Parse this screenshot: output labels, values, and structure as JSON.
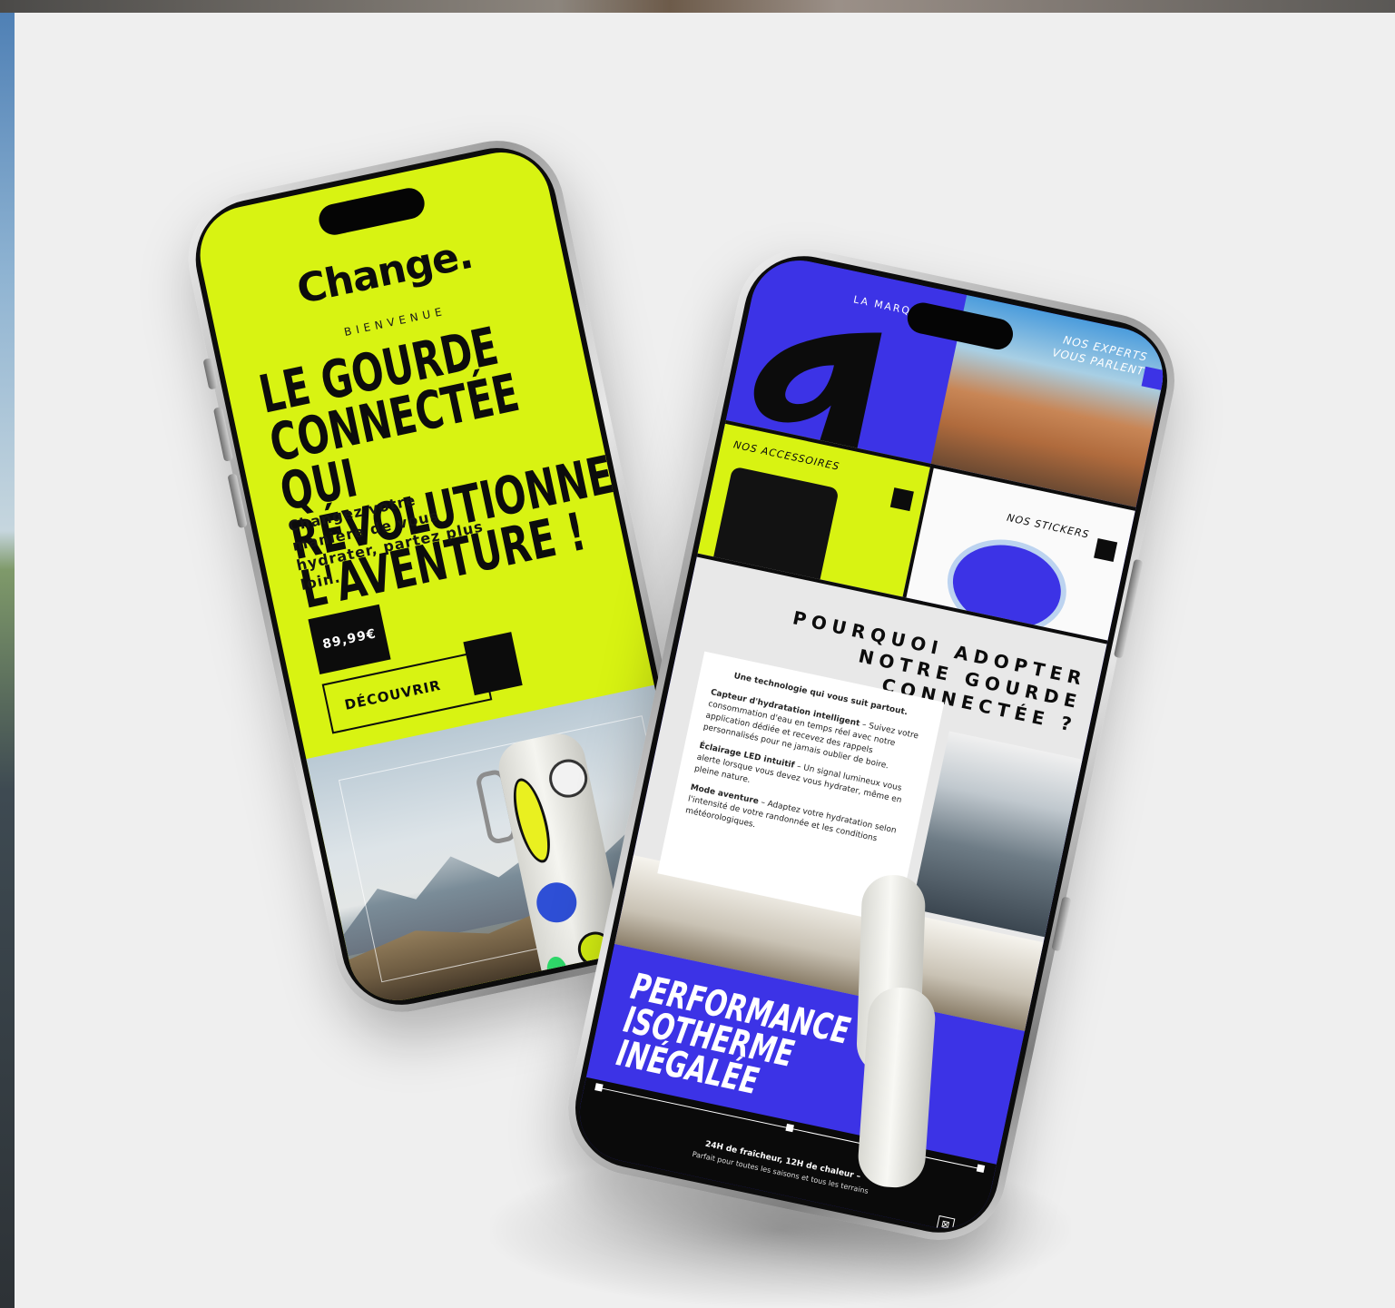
{
  "background": {
    "accent_yellow": "#d8f312",
    "accent_blue": "#3c33e6",
    "dark": "#0c0c0c"
  },
  "phone_left": {
    "logo": "Change.",
    "eyebrow": "BIENVENUE",
    "headline": "LE GOURDE CONNECTÉE QUI RÉVOLUTIONNE L'AVENTURE !",
    "subtitle": "Changez votre manière de vous hydrater, partez plus loin.",
    "price": "89,99€",
    "cta_label": "DÉCOUVRIR"
  },
  "phone_right": {
    "tiles": {
      "brand_label": "LA MARQUE",
      "experts_label": "NOS EXPERTS VOUS PARLENT",
      "accessories_label": "NOS ACCESSOIRES",
      "stickers_label": "NOS STICKERS"
    },
    "why": {
      "title": "POURQUOI ADOPTER NOTRE GOURDE CONNECTÉE ?",
      "intro": "Une technologie qui vous suit partout.",
      "features": [
        {
          "name": "Capteur d'hydratation intelligent",
          "text": " – Suivez votre consommation d'eau en temps réel avec notre application dédiée et recevez des rappels personnalisés pour ne jamais oublier de boire."
        },
        {
          "name": "Éclairage LED intuitif",
          "text": " – Un signal lumineux vous alerte lorsque vous devez vous hydrater, même en pleine nature."
        },
        {
          "name": "Mode aventure",
          "text": " – Adaptez votre hydratation selon l'intensité de votre randonnée et les conditions météorologiques."
        }
      ]
    },
    "performance": {
      "line1": "PERFORMANCE",
      "line2": "ISOTHERME",
      "line3": "INÉGALÉE"
    },
    "footer": {
      "line1": "24H de fraîcheur, 12H de chaleur –",
      "line2": "Parfait pour toutes les saisons et tous les terrains"
    }
  }
}
